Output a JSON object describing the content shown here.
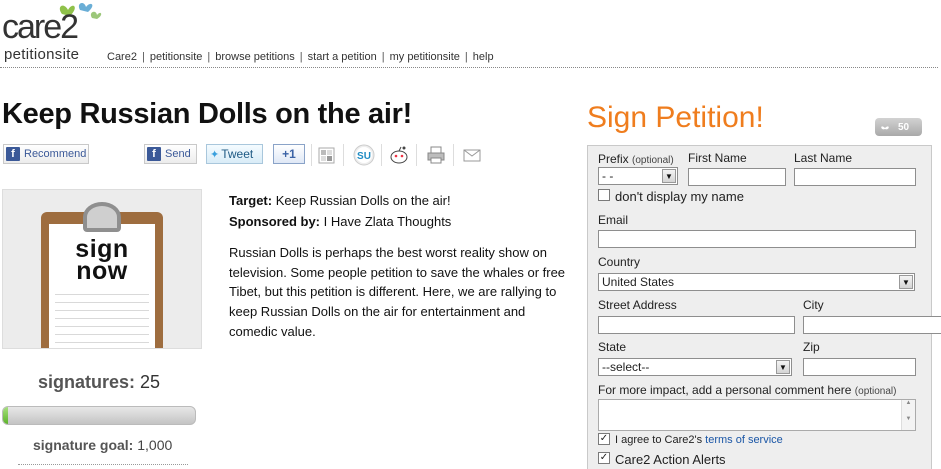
{
  "header": {
    "logo_main": "care2",
    "logo_sub": "petitionsite",
    "nav": [
      "Care2",
      "petitionsite",
      "browse petitions",
      "start a petition",
      "my petitionsite",
      "help"
    ]
  },
  "petition": {
    "title": "Keep Russian Dolls on the air!",
    "target_label": "Target:",
    "target_value": "Keep Russian Dolls on the air!",
    "sponsor_label": "Sponsored by:",
    "sponsor_value": "I Have Zlata Thoughts",
    "description": "Russian Dolls is perhaps the best worst reality show on television. Some people petition to save the whales or free Tibet, but this petition is different.  Here, we are rallying to keep Russian Dolls on the air for entertainment and comedic value.",
    "image_text_line1": "sign",
    "image_text_line2": "now"
  },
  "share": {
    "recommend": "Recommend",
    "send": "Send",
    "tweet": "Tweet",
    "plus_one": "+1",
    "icons": [
      "delicious-icon",
      "stumbleupon-icon",
      "reddit-icon",
      "print-icon",
      "email-icon"
    ]
  },
  "stats": {
    "signatures_label": "signatures:",
    "signatures_value": "25",
    "goal_label": "signature goal:",
    "goal_value": "1,000",
    "progress_fraction": 0.025
  },
  "form": {
    "title": "Sign Petition!",
    "counter": "50",
    "prefix_label": "Prefix",
    "prefix_optional": "(optional)",
    "prefix_value": "- -",
    "first_name_label": "First Name",
    "last_name_label": "Last Name",
    "dont_display": "don't display my name",
    "email_label": "Email",
    "country_label": "Country",
    "country_value": "United States",
    "street_label": "Street Address",
    "city_label": "City",
    "state_label": "State",
    "state_value": "--select--",
    "zip_label": "Zip",
    "comment_label": "For more impact, add a personal comment here",
    "comment_optional": "(optional)",
    "agree_text": "I agree to Care2's",
    "tos_link": "terms of service",
    "alerts_label": "Care2 Action Alerts"
  },
  "colors": {
    "accent_orange": "#ef7d1e",
    "progress_green": "#5cb32a",
    "link_blue": "#1a56a6"
  }
}
